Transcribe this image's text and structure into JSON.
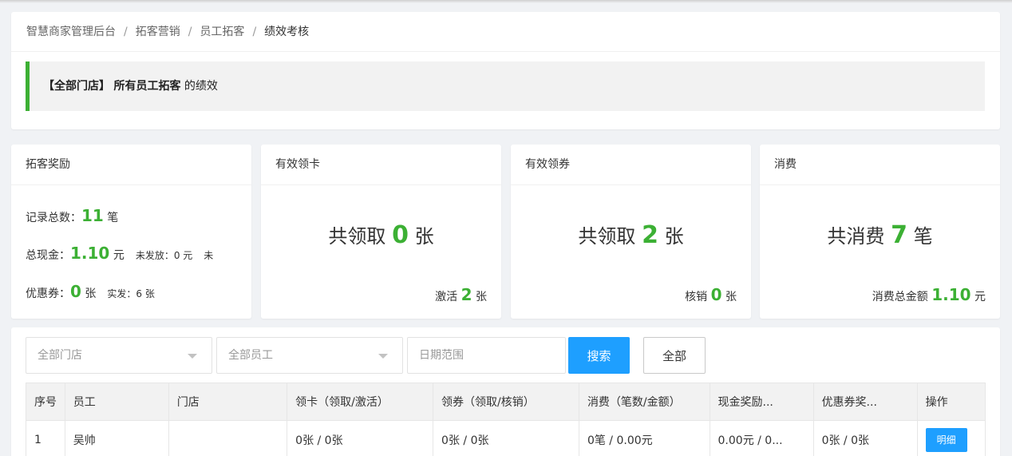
{
  "breadcrumb": {
    "items": [
      "智慧商家管理后台",
      "拓客营销",
      "员工拓客"
    ],
    "separator": "/",
    "current": "绩效考核"
  },
  "notice": {
    "store": "【全部门店】",
    "scope": "所有员工拓客",
    "suffix": "的绩效"
  },
  "stats": {
    "reward": {
      "title": "拓客奖励",
      "records_label": "记录总数：",
      "records_value": "11",
      "records_unit": "笔",
      "cash_label": "总现金：",
      "cash_value": "1.10",
      "cash_unit": "元",
      "unpaid_text": "未发放：0 元",
      "unpaid_trail": "未",
      "coupon_label": "优惠券：",
      "coupon_value": "0",
      "coupon_unit": "张",
      "issued_text": "实发：6 张"
    },
    "cards": {
      "title": "有效领卡",
      "main_prefix": "共领取",
      "main_value": "0",
      "main_unit": "张",
      "sub_label": "激活",
      "sub_value": "2",
      "sub_unit": "张"
    },
    "coupons": {
      "title": "有效领券",
      "main_prefix": "共领取",
      "main_value": "2",
      "main_unit": "张",
      "sub_label": "核销",
      "sub_value": "0",
      "sub_unit": "张"
    },
    "consume": {
      "title": "消费",
      "main_prefix": "共消费",
      "main_value": "7",
      "main_unit": "笔",
      "sub_label": "消费总金额",
      "sub_value": "1.10",
      "sub_unit": "元"
    }
  },
  "filters": {
    "store_select": "全部门店",
    "employee_select": "全部员工",
    "date_placeholder": "日期范围",
    "search_label": "搜索",
    "all_label": "全部"
  },
  "table": {
    "headers": [
      "序号",
      "员工",
      "门店",
      "领卡（领取/激活）",
      "领券（领取/核销）",
      "消费（笔数/金额）",
      "现金奖励...",
      "优惠券奖...",
      "操作"
    ],
    "rows": [
      {
        "index": "1",
        "employee": "吴帅",
        "store": "",
        "cards": "0张 / 0张",
        "coupons": "0张 / 0张",
        "consume": "0笔 / 0.00元",
        "cash": "0.00元 / 0...",
        "coupon_reward": "0张 / 0张",
        "action": "明细"
      }
    ]
  },
  "colors": {
    "accent_green": "#3cb034",
    "primary_blue": "#1e9fff"
  }
}
